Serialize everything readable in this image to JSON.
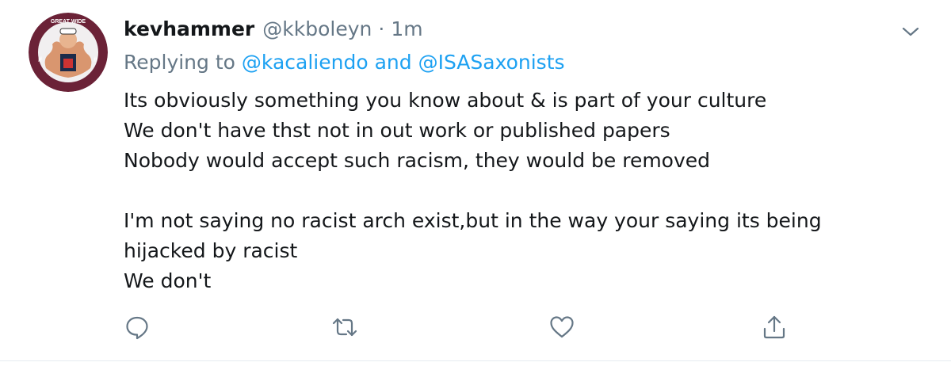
{
  "tweet": {
    "display_name": "kevhammer",
    "handle": "@kkboleyn",
    "separator": "·",
    "timestamp": "1m",
    "replying_prefix": "Replying to",
    "replying_user_1": "@kacaliendo",
    "replying_and": "and",
    "replying_user_2": "@ISASaxonists",
    "body_lines": [
      "Its obviously something you know about & is part of your culture",
      "We don't have thst not in out work or published papers",
      "Nobody would accept such racism,  they would be removed",
      "",
      "I'm not saying no racist arch exist,but in the way your saying its being",
      "hijacked by racist",
      "We don't"
    ],
    "avatar_text": "GREAT WIDE"
  },
  "icons": {
    "menu": "chevron-down-icon",
    "reply": "reply-icon",
    "retweet": "retweet-icon",
    "like": "heart-icon",
    "share": "share-icon"
  },
  "colors": {
    "text": "#14171a",
    "secondary": "#657786",
    "link": "#1da1f2",
    "avatar_ring": "#6b2237"
  }
}
